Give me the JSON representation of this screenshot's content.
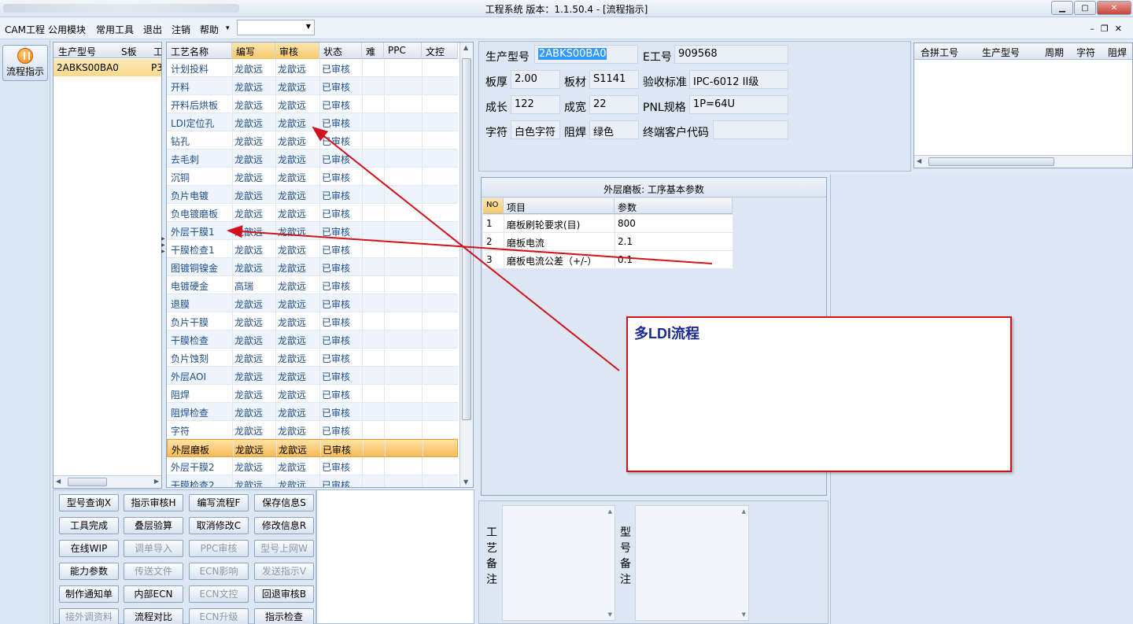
{
  "window": {
    "title": "工程系统   版本：1.1.50.4 - [流程指示]",
    "controls": [
      "minimize",
      "maximize",
      "close"
    ]
  },
  "menu": {
    "items": [
      "CAM工程",
      "公用模块",
      "常用工具",
      "退出",
      "注销",
      "帮助"
    ],
    "help_arrow": "▾",
    "combo_value": ""
  },
  "toolbar": {
    "flow_button_label": "流程指示"
  },
  "product_grid": {
    "columns": [
      "生产型号",
      "S板",
      "工"
    ],
    "rows": [
      {
        "model": "2ABKS00BA0",
        "s_board": "",
        "extra": "P3"
      }
    ]
  },
  "process_grid": {
    "columns": [
      "工艺名称",
      "编写",
      "审核",
      "状态",
      "难",
      "PPC",
      "文控"
    ],
    "rows": [
      {
        "name": "计划投料",
        "writer": "龙歆远",
        "reviewer": "龙歆远",
        "status": "已审核"
      },
      {
        "name": "开料",
        "writer": "龙歆远",
        "reviewer": "龙歆远",
        "status": "已审核"
      },
      {
        "name": "开料后烘板",
        "writer": "龙歆远",
        "reviewer": "龙歆远",
        "status": "已审核"
      },
      {
        "name": "LDI定位孔",
        "writer": "龙歆远",
        "reviewer": "龙歆远",
        "status": "已审核"
      },
      {
        "name": "钻孔",
        "writer": "龙歆远",
        "reviewer": "龙歆远",
        "status": "已审核"
      },
      {
        "name": "去毛刺",
        "writer": "龙歆远",
        "reviewer": "龙歆远",
        "status": "已审核"
      },
      {
        "name": "沉铜",
        "writer": "龙歆远",
        "reviewer": "龙歆远",
        "status": "已审核"
      },
      {
        "name": "负片电镀",
        "writer": "龙歆远",
        "reviewer": "龙歆远",
        "status": "已审核"
      },
      {
        "name": "负电镀磨板",
        "writer": "龙歆远",
        "reviewer": "龙歆远",
        "status": "已审核"
      },
      {
        "name": "外层干膜1",
        "writer": "龙歆远",
        "reviewer": "龙歆远",
        "status": "已审核"
      },
      {
        "name": "干膜检查1",
        "writer": "龙歆远",
        "reviewer": "龙歆远",
        "status": "已审核"
      },
      {
        "name": "图镀铜镍金",
        "writer": "龙歆远",
        "reviewer": "龙歆远",
        "status": "已审核"
      },
      {
        "name": "电镀硬金",
        "writer": "高瑞",
        "reviewer": "龙歆远",
        "status": "已审核"
      },
      {
        "name": "退膜",
        "writer": "龙歆远",
        "reviewer": "龙歆远",
        "status": "已审核"
      },
      {
        "name": "负片干膜",
        "writer": "龙歆远",
        "reviewer": "龙歆远",
        "status": "已审核"
      },
      {
        "name": "干膜检查",
        "writer": "龙歆远",
        "reviewer": "龙歆远",
        "status": "已审核"
      },
      {
        "name": "负片蚀刻",
        "writer": "龙歆远",
        "reviewer": "龙歆远",
        "status": "已审核"
      },
      {
        "name": "外层AOI",
        "writer": "龙歆远",
        "reviewer": "龙歆远",
        "status": "已审核"
      },
      {
        "name": "阻焊",
        "writer": "龙歆远",
        "reviewer": "龙歆远",
        "status": "已审核"
      },
      {
        "name": "阻焊检查",
        "writer": "龙歆远",
        "reviewer": "龙歆远",
        "status": "已审核"
      },
      {
        "name": "字符",
        "writer": "龙歆远",
        "reviewer": "龙歆远",
        "status": "已审核"
      },
      {
        "name": "外层磨板",
        "writer": "龙歆远",
        "reviewer": "龙歆远",
        "status": "已审核"
      },
      {
        "name": "外层干膜2",
        "writer": "龙歆远",
        "reviewer": "龙歆远",
        "status": "已审核"
      },
      {
        "name": "干膜检查2",
        "writer": "龙歆远",
        "reviewer": "龙歆远",
        "status": "已审核"
      }
    ],
    "selected_row": 21
  },
  "buttons": [
    {
      "label": "型号查询X",
      "enabled": true
    },
    {
      "label": "指示审核H",
      "enabled": true
    },
    {
      "label": "编写流程F",
      "enabled": true
    },
    {
      "label": "保存信息S",
      "enabled": true
    },
    {
      "label": "工具完成",
      "enabled": true
    },
    {
      "label": "叠层验算",
      "enabled": true
    },
    {
      "label": "取消修改C",
      "enabled": true
    },
    {
      "label": "修改信息R",
      "enabled": true
    },
    {
      "label": "在线WIP",
      "enabled": true
    },
    {
      "label": "调单导入",
      "enabled": false
    },
    {
      "label": "PPC审核",
      "enabled": false
    },
    {
      "label": "型号上网W",
      "enabled": false
    },
    {
      "label": "能力参数",
      "enabled": true
    },
    {
      "label": "传送文件",
      "enabled": false
    },
    {
      "label": "ECN影响",
      "enabled": false
    },
    {
      "label": "发送指示V",
      "enabled": false
    },
    {
      "label": "制作通知单",
      "enabled": true
    },
    {
      "label": "内部ECN",
      "enabled": true
    },
    {
      "label": "ECN文控",
      "enabled": false
    },
    {
      "label": "回退审核B",
      "enabled": true
    },
    {
      "label": "接外调资料",
      "enabled": false
    },
    {
      "label": "流程对比",
      "enabled": true
    },
    {
      "label": "ECN升级",
      "enabled": false
    },
    {
      "label": "指示检查",
      "enabled": true
    }
  ],
  "info": {
    "model_label": "生产型号",
    "model_value": "2ABKS00BA0",
    "e_no_label": "E工号",
    "e_no_value": "909568",
    "thickness_label": "板厚",
    "thickness_value": "2.00",
    "material_label": "板材",
    "material_value": "S1141",
    "standard_label": "验收标准",
    "standard_value": "IPC-6012 II级",
    "length_label": "成长",
    "length_value": "122",
    "width_label": "成宽",
    "width_value": "22",
    "pnl_label": "PNL规格",
    "pnl_value": "1P=64U",
    "char_label": "字符",
    "char_value": "白色字符",
    "mask_label": "阻焊",
    "mask_value": "绿色",
    "customer_label": "终端客户代码",
    "customer_value": ""
  },
  "merge_grid": {
    "columns": [
      "合拼工号",
      "生产型号",
      "周期",
      "字符",
      "阻焊"
    ]
  },
  "params": {
    "caption": "外层磨板: 工序基本参数",
    "columns": [
      "NO",
      "项目",
      "参数"
    ],
    "rows": [
      {
        "no": "1",
        "item": "磨板刷轮要求(目)",
        "value": "800"
      },
      {
        "no": "2",
        "item": "磨板电流",
        "value": "2.1"
      },
      {
        "no": "3",
        "item": "磨板电流公差（+/-）",
        "value": "0.1"
      }
    ]
  },
  "remarks": {
    "process_label": "工艺备注",
    "model_label": "型号备注"
  },
  "annotation": {
    "text": "多LDI流程",
    "color": "#d0131b"
  }
}
